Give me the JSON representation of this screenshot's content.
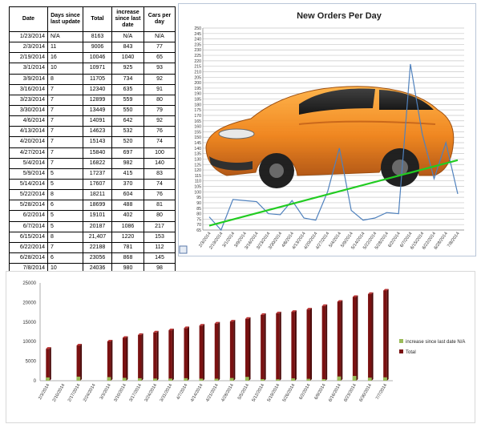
{
  "table": {
    "headers": [
      "Date",
      "Days since last update",
      "Total",
      "increase since last date",
      "Cars per day"
    ],
    "rows": [
      [
        "1/23/2014",
        "N/A",
        "8163",
        "N/A",
        "N/A"
      ],
      [
        "2/3/2014",
        "11",
        "9006",
        "843",
        "77"
      ],
      [
        "2/19/2014",
        "16",
        "10046",
        "1040",
        "65"
      ],
      [
        "3/1/2014",
        "10",
        "10971",
        "925",
        "93"
      ],
      [
        "3/9/2014",
        "8",
        "11705",
        "734",
        "92"
      ],
      [
        "3/16/2014",
        "7",
        "12340",
        "635",
        "91"
      ],
      [
        "3/23/2014",
        "7",
        "12899",
        "559",
        "80"
      ],
      [
        "3/30/2014",
        "7",
        "13449",
        "550",
        "79"
      ],
      [
        "4/6/2014",
        "7",
        "14091",
        "642",
        "92"
      ],
      [
        "4/13/2014",
        "7",
        "14623",
        "532",
        "76"
      ],
      [
        "4/20/2014",
        "7",
        "15143",
        "520",
        "74"
      ],
      [
        "4/27/2014",
        "7",
        "15840",
        "697",
        "100"
      ],
      [
        "5/4/2014",
        "7",
        "16822",
        "982",
        "140"
      ],
      [
        "5/9/2014",
        "5",
        "17237",
        "415",
        "83"
      ],
      [
        "5/14/2014",
        "5",
        "17607",
        "370",
        "74"
      ],
      [
        "5/22/2014",
        "8",
        "18211",
        "604",
        "76"
      ],
      [
        "5/28/2014",
        "6",
        "18699",
        "488",
        "81"
      ],
      [
        "6/2/2014",
        "5",
        "19101",
        "402",
        "80"
      ],
      [
        "6/7/2014",
        "5",
        "20187",
        "1086",
        "217"
      ],
      [
        "6/15/2014",
        "8",
        "21,407",
        "1220",
        "153"
      ],
      [
        "6/22/2014",
        "7",
        "22188",
        "781",
        "112"
      ],
      [
        "6/28/2014",
        "6",
        "23056",
        "868",
        "145"
      ],
      [
        "7/8/2014",
        "10",
        "24036",
        "980",
        "98"
      ],
      [
        "7/13/2014",
        "5",
        "24507",
        "471",
        "94"
      ],
      [
        "7/21/2014",
        "8",
        "25166",
        "659",
        "82"
      ]
    ]
  },
  "chart_data": [
    {
      "type": "line",
      "title": "New Orders Per Day",
      "x": [
        "2/3/2014",
        "2/19/2014",
        "3/1/2014",
        "3/9/2014",
        "3/16/2014",
        "3/23/2014",
        "3/30/2014",
        "4/6/2014",
        "4/13/2014",
        "4/20/2014",
        "4/27/2014",
        "5/4/2014",
        "5/9/2014",
        "5/14/2014",
        "5/22/2014",
        "5/28/2014",
        "6/2/2014",
        "6/7/2014",
        "6/15/2014",
        "6/22/2014",
        "6/28/2014",
        "7/8/2014"
      ],
      "series": [
        {
          "values": [
            77,
            65,
            93,
            92,
            91,
            80,
            79,
            92,
            76,
            74,
            100,
            140,
            83,
            74,
            76,
            81,
            80,
            217,
            153,
            112,
            145,
            98
          ],
          "color": "#4f81bd"
        }
      ],
      "trendline": {
        "start": 69,
        "end": 129,
        "color": "#22cc22"
      },
      "ylim": [
        65,
        250
      ],
      "ytick_step": 5,
      "background_image": "orange three-wheeled car",
      "grid": true
    },
    {
      "type": "bar",
      "categories": [
        "2/3/2014",
        "2/10/2014",
        "2/17/2014",
        "2/24/2014",
        "3/3/2014",
        "3/10/2014",
        "3/17/2014",
        "3/24/2014",
        "3/31/2014",
        "4/7/2014",
        "4/14/2014",
        "4/21/2014",
        "4/28/2014",
        "5/5/2014",
        "5/12/2014",
        "5/19/2014",
        "5/26/2014",
        "6/2/2014",
        "6/9/2014",
        "6/16/2014",
        "6/23/2014",
        "6/30/2014",
        "7/7/2014"
      ],
      "series": [
        {
          "name": "increase since last date N/A",
          "color": "#9bbb59",
          "values": [
            843,
            0,
            1040,
            0,
            925,
            734,
            635,
            559,
            550,
            642,
            532,
            520,
            697,
            982,
            415,
            370,
            604,
            488,
            402,
            1086,
            1220,
            781,
            868
          ]
        },
        {
          "name": "Total",
          "color": "#7a1111",
          "values": [
            8163,
            0,
            9006,
            0,
            10046,
            10971,
            11705,
            12340,
            12899,
            13449,
            14091,
            14623,
            15143,
            15840,
            16822,
            17237,
            17607,
            18211,
            19101,
            20187,
            21407,
            22188,
            23056
          ]
        }
      ],
      "ylim": [
        0,
        25000
      ],
      "yticks": [
        0,
        5000,
        10000,
        15000,
        20000,
        25000
      ],
      "legend": "right",
      "grid": false
    }
  ]
}
